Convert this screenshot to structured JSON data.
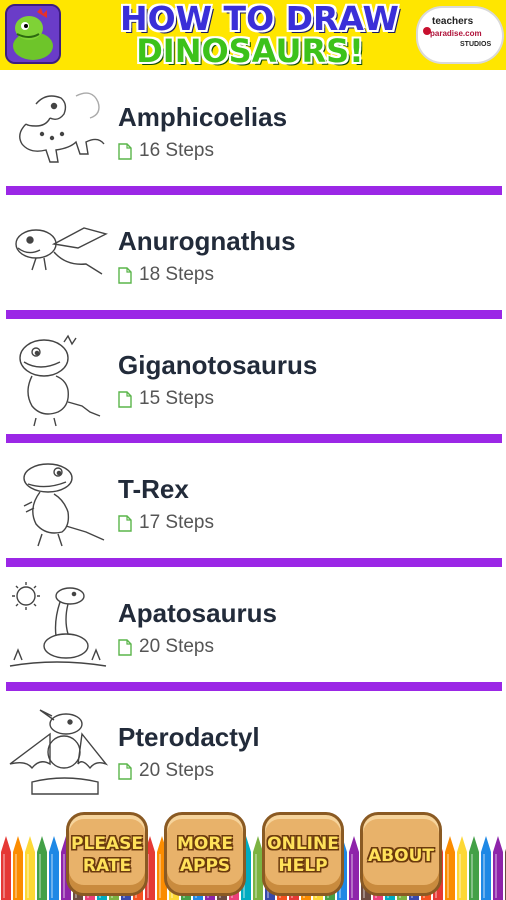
{
  "header": {
    "title_line1": "HOW TO DRAW",
    "title_line2": "DINOSAURS!",
    "studio_logo_line1": "teachers",
    "studio_logo_line2": "paradise.com",
    "studio_logo_line3": "STUDIOS"
  },
  "list": {
    "items": [
      {
        "name": "Amphicoelias",
        "steps": "16 Steps",
        "thumb_icon": "amphicoelias-drawing"
      },
      {
        "name": "Anurognathus",
        "steps": "18 Steps",
        "thumb_icon": "anurognathus-drawing"
      },
      {
        "name": "Giganotosaurus",
        "steps": "15 Steps",
        "thumb_icon": "giganotosaurus-drawing"
      },
      {
        "name": "T-Rex",
        "steps": "17 Steps",
        "thumb_icon": "t-rex-drawing"
      },
      {
        "name": "Apatosaurus",
        "steps": "20 Steps",
        "thumb_icon": "apatosaurus-drawing"
      },
      {
        "name": "Pterodactyl",
        "steps": "20 Steps",
        "thumb_icon": "pterodactyl-drawing"
      }
    ]
  },
  "footer": {
    "buttons": [
      {
        "line1": "PLEASE",
        "line2": "RATE"
      },
      {
        "line1": "MORE",
        "line2": "APPS"
      },
      {
        "line1": "ONLINE",
        "line2": "HELP"
      },
      {
        "line1": "ABOUT",
        "line2": ""
      }
    ]
  },
  "colors": {
    "header_bg": "#ffe600",
    "divider": "#9b27e6",
    "title_blue": "#3a2fd8",
    "title_green": "#3cc21a",
    "button_tan": "#e8b26a"
  }
}
